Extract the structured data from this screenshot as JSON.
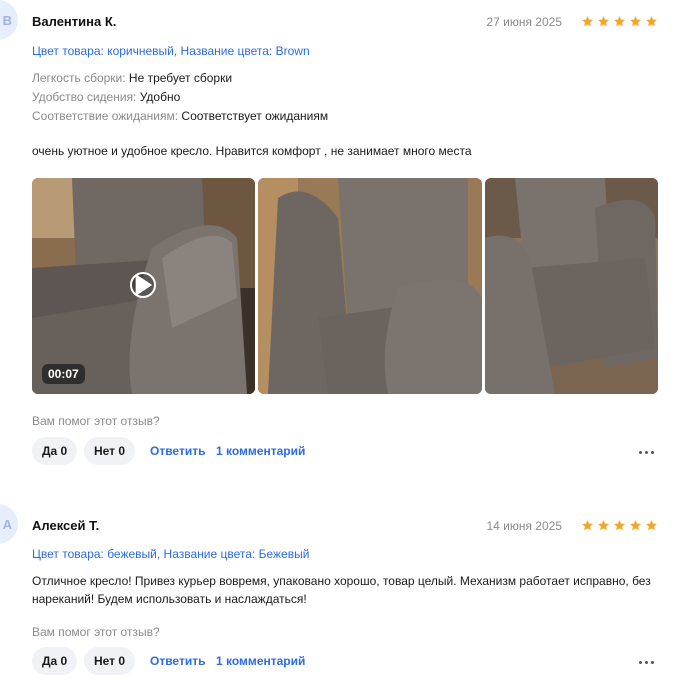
{
  "reviews": [
    {
      "avatar_letter": "В",
      "author": "Валентина К.",
      "date": "27 июня 2025",
      "rating": 5,
      "variant": "Цвет товара: коричневый, Название цвета: Brown",
      "attributes": [
        {
          "key": "Легкость сборки:",
          "value": "Не требует сборки"
        },
        {
          "key": "Удобство сидения:",
          "value": "Удобно"
        },
        {
          "key": "Соответствие ожиданиям:",
          "value": "Соответствует ожиданиям"
        }
      ],
      "text": "очень уютное и удобное кресло. Нравится комфорт , не занимает много места",
      "video_duration": "00:07",
      "helpful_question": "Вам помог этот отзыв?",
      "yes_label": "Да 0",
      "no_label": "Нет 0",
      "reply_label": "Ответить",
      "comments_label": "1 комментарий"
    },
    {
      "avatar_letter": "А",
      "author": "Алексей Т.",
      "date": "14 июня 2025",
      "rating": 5,
      "variant": "Цвет товара: бежевый, Название цвета: Бежевый",
      "text": "Отличное кресло! Привез курьер вовремя, упаковано хорошо, товар целый. Механизм работает исправно, без нареканий! Будем использовать и наслаждаться!",
      "helpful_question": "Вам помог этот отзыв?",
      "yes_label": "Да 0",
      "no_label": "Нет 0",
      "reply_label": "Ответить",
      "comments_label": "1 комментарий"
    }
  ],
  "colors": {
    "accent": "#2b6be6",
    "star": "#f5a623",
    "muted": "#8a8a8a",
    "button_bg": "#f1f2f5"
  },
  "icons": {
    "star": "star-icon",
    "play": "play-icon",
    "more": "more-dots-icon"
  }
}
